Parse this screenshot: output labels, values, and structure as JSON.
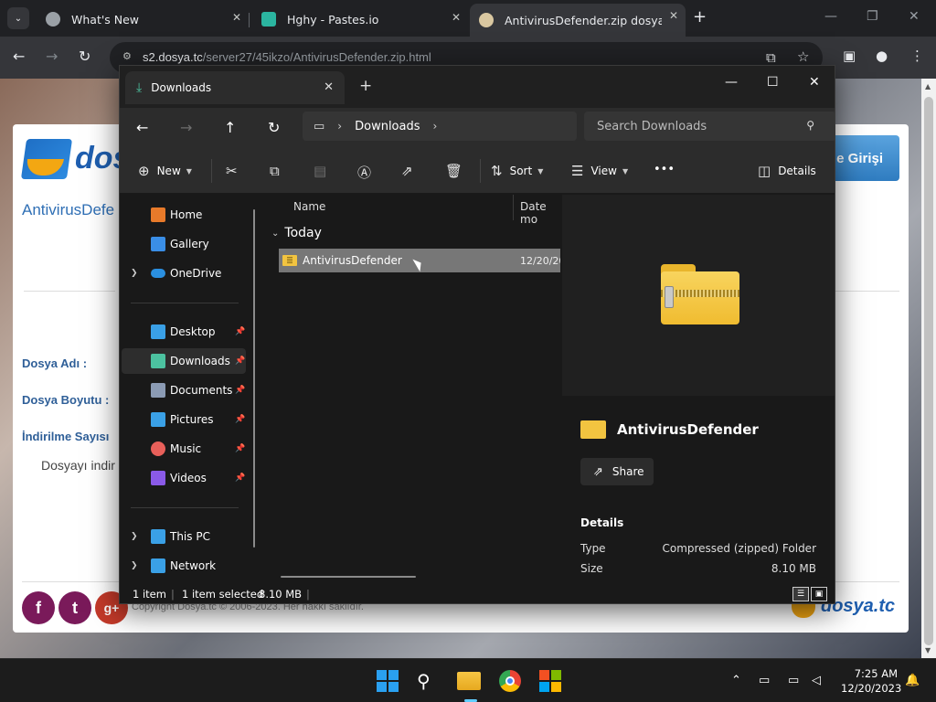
{
  "browser": {
    "tabs": [
      {
        "title": "What's New",
        "active": false
      },
      {
        "title": "Hghy - Pastes.io",
        "active": false
      },
      {
        "title": "AntivirusDefender.zip dosyasını",
        "active": true
      }
    ],
    "new_tab": "+",
    "url_host": "s2.dosya.tc",
    "url_path": "/server27/45ikzo/AntivirusDefender.zip.html",
    "colors": {
      "frame": "#202124",
      "toolbar": "#35363a"
    }
  },
  "webpage": {
    "logo_text": "dos",
    "login_button": "e Girişi",
    "file_title": "AntivirusDefe",
    "labels": {
      "file_name": "Dosya Adı :",
      "file_size": "Dosya Boyutu :",
      "download_count": "İndirilme Sayısı"
    },
    "download_text": "Dosyayı indir",
    "copyright": "Copyright Dosya.tc © 2006-2023. Her hakkı saklıdır.",
    "footer_logo": "dosya.tc",
    "social": [
      "f",
      "t",
      "g+"
    ]
  },
  "explorer": {
    "tab_title": "Downloads",
    "address": {
      "location": "Downloads"
    },
    "search_placeholder": "Search Downloads",
    "commands": {
      "new": "New",
      "sort": "Sort",
      "view": "View",
      "more": "•••",
      "details": "Details"
    },
    "sidebar": [
      {
        "label": "Home",
        "icon": "home-icon",
        "color": "#e87a2a"
      },
      {
        "label": "Gallery",
        "icon": "gallery-icon",
        "color": "#3a8ee6"
      },
      {
        "label": "OneDrive",
        "icon": "cloud-icon",
        "color": "#2a8fe0",
        "expandable": true
      },
      {
        "label": "Desktop",
        "icon": "desktop-icon",
        "color": "#3aa0e6",
        "pinned": true
      },
      {
        "label": "Downloads",
        "icon": "download-icon",
        "color": "#4cc2a0",
        "pinned": true,
        "selected": true
      },
      {
        "label": "Documents",
        "icon": "document-icon",
        "color": "#8b9bb4",
        "pinned": true
      },
      {
        "label": "Pictures",
        "icon": "pictures-icon",
        "color": "#3aa0e6",
        "pinned": true
      },
      {
        "label": "Music",
        "icon": "music-icon",
        "color": "#e8605a",
        "pinned": true
      },
      {
        "label": "Videos",
        "icon": "videos-icon",
        "color": "#8a5ae8",
        "pinned": true
      },
      {
        "label": "This PC",
        "icon": "pc-icon",
        "color": "#3aa0e6",
        "expandable": true
      },
      {
        "label": "Network",
        "icon": "network-icon",
        "color": "#3aa0e6",
        "expandable": true
      }
    ],
    "columns": {
      "name": "Name",
      "date": "Date mo"
    },
    "group": "Today",
    "files": [
      {
        "name": "AntivirusDefender",
        "date": "12/20/20",
        "selected": true
      }
    ],
    "details_pane": {
      "name": "AntivirusDefender",
      "share": "Share",
      "heading": "Details",
      "rows": [
        {
          "key": "Type",
          "value": "Compressed (zipped) Folder"
        },
        {
          "key": "Size",
          "value": "8.10 MB"
        }
      ]
    },
    "status": {
      "count": "1 item",
      "selected": "1 item selected",
      "size": "8.10 MB"
    }
  },
  "taskbar": {
    "time": "7:25 AM",
    "date": "12/20/2023"
  }
}
